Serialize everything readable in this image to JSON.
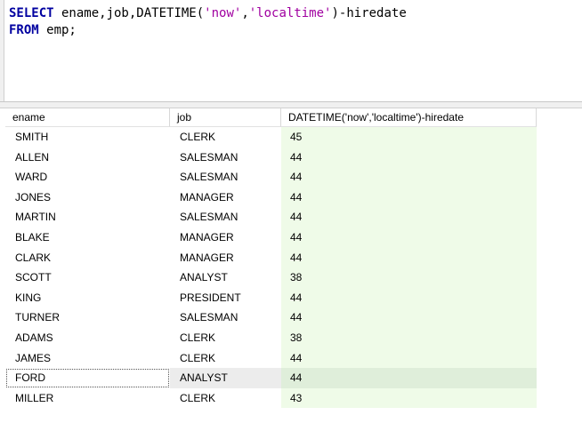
{
  "editor": {
    "line1": {
      "kw": "SELECT",
      "p1": " ename,job,DATETIME(",
      "s1": "'now'",
      "p2": ",",
      "s2": "'localtime'",
      "p3": ")-hiredate"
    },
    "line2": {
      "kw": "FROM",
      "p1": " emp;"
    }
  },
  "grid": {
    "columns": [
      "ename",
      "job",
      "DATETIME('now','localtime')-hiredate"
    ],
    "rows": [
      [
        "SMITH",
        "CLERK",
        "45"
      ],
      [
        "ALLEN",
        "SALESMAN",
        "44"
      ],
      [
        "WARD",
        "SALESMAN",
        "44"
      ],
      [
        "JONES",
        "MANAGER",
        "44"
      ],
      [
        "MARTIN",
        "SALESMAN",
        "44"
      ],
      [
        "BLAKE",
        "MANAGER",
        "44"
      ],
      [
        "CLARK",
        "MANAGER",
        "44"
      ],
      [
        "SCOTT",
        "ANALYST",
        "38"
      ],
      [
        "KING",
        "PRESIDENT",
        "44"
      ],
      [
        "TURNER",
        "SALESMAN",
        "44"
      ],
      [
        "ADAMS",
        "CLERK",
        "38"
      ],
      [
        "JAMES",
        "CLERK",
        "44"
      ],
      [
        "FORD",
        "ANALYST",
        "44"
      ],
      [
        "MILLER",
        "CLERK",
        "43"
      ]
    ]
  },
  "colors": {
    "keyword": "#0000a0",
    "string": "#a000a0",
    "result_cell_bg": "#effbe8"
  }
}
